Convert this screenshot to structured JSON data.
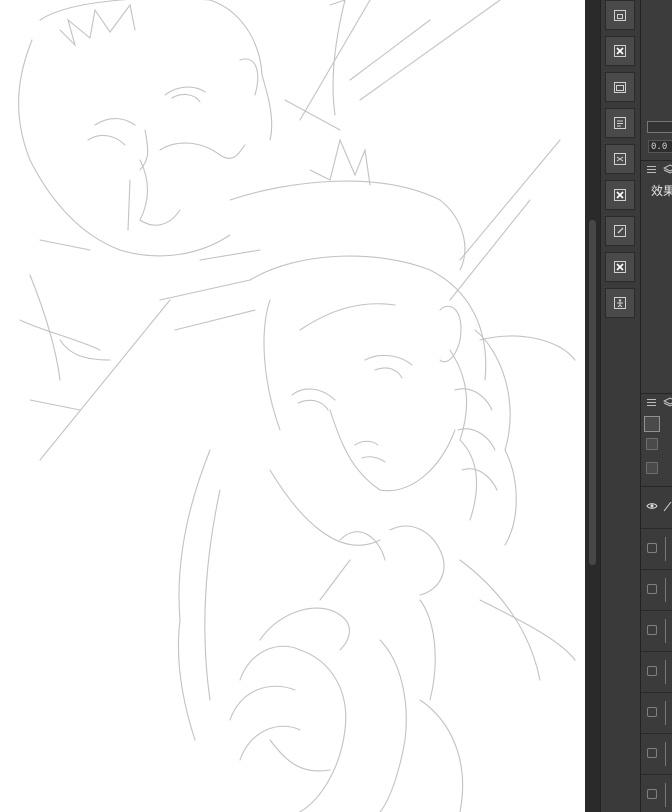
{
  "canvas": {
    "artwork": "line sketch"
  },
  "toolbar": {
    "buttons": [
      {
        "name": "new-layer-folder-icon"
      },
      {
        "name": "delete-icon"
      },
      {
        "name": "layer-copy-icon"
      },
      {
        "name": "layer-property-icon"
      },
      {
        "name": "merge-layer-icon"
      },
      {
        "name": "delete-icon"
      },
      {
        "name": "edit-icon"
      },
      {
        "name": "delete-icon"
      },
      {
        "name": "figure-icon"
      }
    ]
  },
  "property_panel": {
    "value": "0.0",
    "effect_label": "效果"
  },
  "layer_panel": {
    "rows": 8
  },
  "colors": {
    "panel_bg": "#3c3c3c",
    "toolbar_bg": "#3a3a3a",
    "button_bg": "#4a4a4a",
    "sketch_line": "#bdbdbd"
  }
}
